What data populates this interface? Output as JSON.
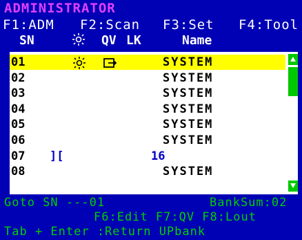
{
  "title": "ADMINISTRATOR",
  "fkeys_top": [
    "F1:ADM",
    "F2:Scan",
    "F3:Set",
    "F4:Tool"
  ],
  "headers": {
    "sn": "SN",
    "qv": "QV",
    "lk": "LK",
    "name": "Name"
  },
  "rows": [
    {
      "sn": "01",
      "name": "SYSTEM",
      "selected": true,
      "sun": true,
      "qv": true
    },
    {
      "sn": "02",
      "name": "SYSTEM"
    },
    {
      "sn": "03",
      "name": "SYSTEM"
    },
    {
      "sn": "04",
      "name": "SYSTEM"
    },
    {
      "sn": "05",
      "name": "SYSTEM"
    },
    {
      "sn": "06",
      "name": "SYSTEM"
    },
    {
      "sn": "07",
      "name": "",
      "lk": "][",
      "value": "16"
    },
    {
      "sn": "08",
      "name": "SYSTEM"
    }
  ],
  "bottom": {
    "goto": "Goto  SN  ---01",
    "banksum": "BankSum:02",
    "fkeys_bottom": "F6:Edit  F7:QV   F8:Lout",
    "hint": "Tab + Enter :Return UPbank"
  },
  "colors": {
    "background": "#0000b4",
    "title": "#e040ff",
    "selected_row": "#ffff00",
    "scroll_thumb": "#00c800",
    "status_text": "#00d000"
  },
  "icons": {
    "brightness": "sun-icon",
    "quick_view": "quick-view-icon",
    "scroll_up": "scroll-up-icon",
    "scroll_down": "scroll-down-icon"
  }
}
